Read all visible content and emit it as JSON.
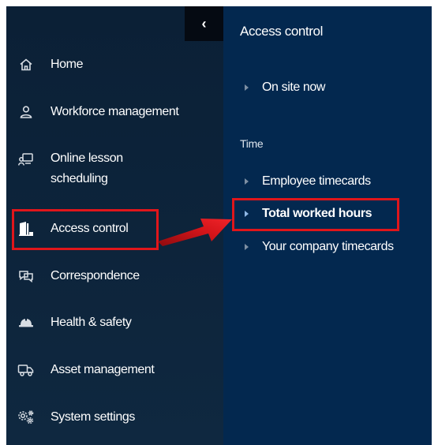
{
  "sidebar": {
    "collapse_icon_glyph": "‹",
    "items": [
      {
        "label": "Home",
        "icon": "home-icon"
      },
      {
        "label": "Workforce management",
        "icon": "user-icon"
      },
      {
        "label": "Online lesson scheduling",
        "label_line1": "Online lesson",
        "label_line2": "scheduling",
        "icon": "lesson-icon"
      },
      {
        "label": "Access control",
        "icon": "access-door-icon"
      },
      {
        "label": "Correspondence",
        "icon": "chat-icon"
      },
      {
        "label": "Health & safety",
        "icon": "hard-hat-icon"
      },
      {
        "label": "Asset management",
        "icon": "truck-icon"
      },
      {
        "label": "System settings",
        "icon": "gears-icon"
      }
    ]
  },
  "panel": {
    "title": "Access control",
    "top_items": [
      {
        "label": "On site now"
      }
    ],
    "section_label": "Time",
    "time_items": [
      {
        "label": "Employee timecards",
        "active": false
      },
      {
        "label": "Total worked hours",
        "active": true
      },
      {
        "label": "Your company timecards",
        "active": false
      }
    ]
  },
  "annotation": {
    "color": "#e0161b"
  }
}
